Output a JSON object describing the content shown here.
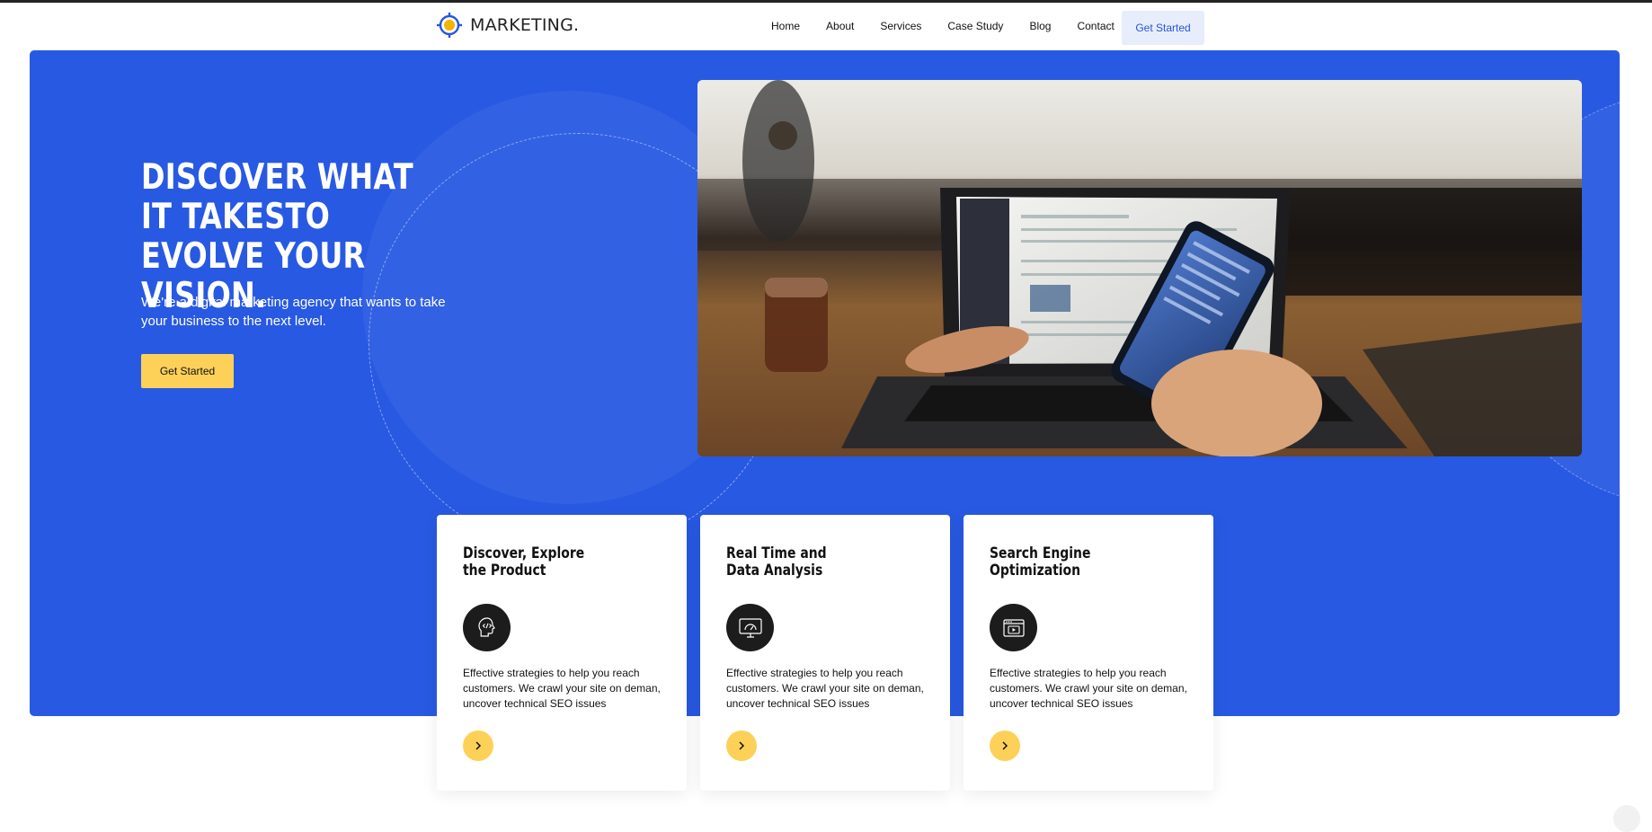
{
  "brand": {
    "name": "MARKETING.",
    "accent": "#f4b400",
    "ring": "#2456e0"
  },
  "nav": {
    "items": [
      {
        "label": "Home"
      },
      {
        "label": "About"
      },
      {
        "label": "Services"
      },
      {
        "label": "Case Study"
      },
      {
        "label": "Blog"
      },
      {
        "label": "Contact"
      }
    ],
    "cta_label": "Get Started"
  },
  "hero": {
    "title": "DISCOVER WHAT IT TAKESTO EVOLVE YOUR VISION.",
    "subtitle": "We're a digital marketing agency that wants to take your business to the next level.",
    "cta_label": "Get Started",
    "background": "#2859e2",
    "photo_alt": "Person using laptop and phone in a cafe"
  },
  "cards": [
    {
      "title": "Discover, Explore the Product",
      "icon": "head-code-icon",
      "text": "Effective strategies to help you reach customers. We crawl your site on deman, uncover technical SEO issues",
      "arrow_icon": "chevron-right-icon"
    },
    {
      "title": "Real Time and Data Analysis",
      "icon": "monitor-gauge-icon",
      "text": "Effective strategies to help you reach customers. We crawl your site on deman, uncover technical SEO issues",
      "arrow_icon": "chevron-right-icon"
    },
    {
      "title": "Search Engine Optimization",
      "icon": "browser-video-icon",
      "text": "Effective strategies to help you reach customers. We crawl your site on deman, uncover technical SEO issues",
      "arrow_icon": "chevron-right-icon"
    }
  ],
  "colors": {
    "primary": "#2859e2",
    "button_yellow": "#fdd158",
    "nav_cta_bg": "#e8edfb"
  }
}
